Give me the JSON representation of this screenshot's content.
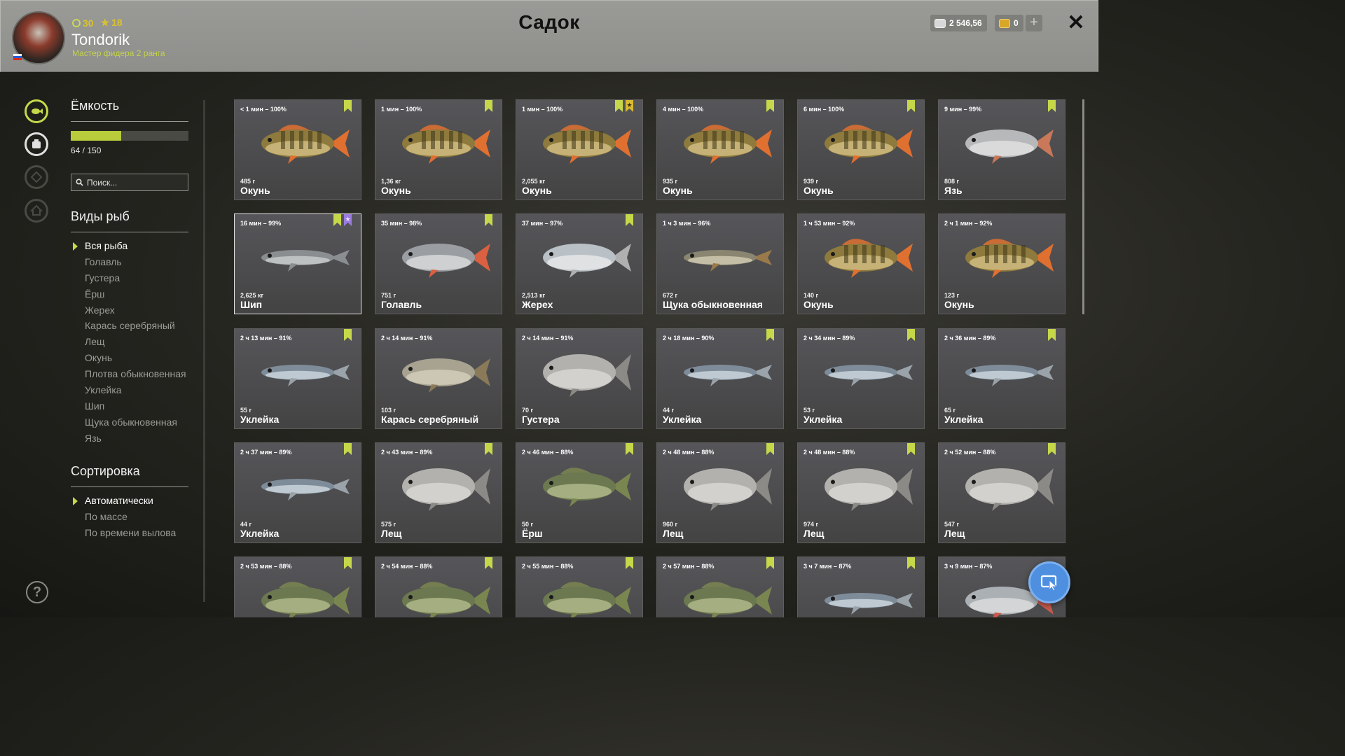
{
  "header": {
    "title": "Садок",
    "username": "Tondorik",
    "rank": "Мастер фидера 2 ранга",
    "level": "30",
    "stars": "18",
    "silver": "2 546,56",
    "gold": "0",
    "close_label": "✕",
    "add_label": "+"
  },
  "sidebar": {
    "capacity_title": "Ёмкость",
    "capacity_text": "64 / 150",
    "capacity_fraction": 0.427,
    "search_placeholder": "Поиск...",
    "species_title": "Виды рыб",
    "species": [
      "Вся рыба",
      "Голавль",
      "Густера",
      "Ёрш",
      "Жерех",
      "Карась серебряный",
      "Лещ",
      "Окунь",
      "Плотва обыкновенная",
      "Уклейка",
      "Шип",
      "Щука обыкновенная",
      "Язь"
    ],
    "species_selected": 0,
    "sort_title": "Сортировка",
    "sort_options": [
      "Автоматически",
      "По массе",
      "По времени вылова"
    ],
    "sort_selected": 0,
    "help_label": "?"
  },
  "colors": {
    "accent": "#c6d84a",
    "bookmark_green": "#c6d84a",
    "bookmark_purple": "#9b7be0",
    "bookmark_gold": "#d9b930",
    "fab": "#4e8fe0"
  },
  "fish": [
    {
      "time": "< 1 мин – 100%",
      "weight": "485 г",
      "name": "Окунь",
      "kind": "perch",
      "marks": [
        "green"
      ]
    },
    {
      "time": "1 мин – 100%",
      "weight": "1,36 кг",
      "name": "Окунь",
      "kind": "perch",
      "marks": [
        "green"
      ]
    },
    {
      "time": "1 мин – 100%",
      "weight": "2,055 кг",
      "name": "Окунь",
      "kind": "perch",
      "marks": [
        "green",
        "gold"
      ]
    },
    {
      "time": "4 мин – 100%",
      "weight": "935 г",
      "name": "Окунь",
      "kind": "perch",
      "marks": [
        "green"
      ]
    },
    {
      "time": "6 мин – 100%",
      "weight": "939 г",
      "name": "Окунь",
      "kind": "perch",
      "marks": [
        "green"
      ]
    },
    {
      "time": "9 мин – 99%",
      "weight": "808 г",
      "name": "Язь",
      "kind": "ide",
      "marks": [
        "green"
      ]
    },
    {
      "time": "16 мин – 99%",
      "weight": "2,625 кг",
      "name": "Шип",
      "kind": "sturgeon",
      "marks": [
        "green",
        "purple"
      ],
      "selected": true
    },
    {
      "time": "35 мин – 98%",
      "weight": "751 г",
      "name": "Голавль",
      "kind": "chub",
      "marks": [
        "green"
      ]
    },
    {
      "time": "37 мин – 97%",
      "weight": "2,513 кг",
      "name": "Жерех",
      "kind": "asp",
      "marks": [
        "green"
      ]
    },
    {
      "time": "1 ч 3 мин – 96%",
      "weight": "672 г",
      "name": "Щука обыкновенная",
      "kind": "pike",
      "marks": []
    },
    {
      "time": "1 ч 53 мин – 92%",
      "weight": "140 г",
      "name": "Окунь",
      "kind": "perch",
      "marks": []
    },
    {
      "time": "2 ч 1 мин – 92%",
      "weight": "123 г",
      "name": "Окунь",
      "kind": "perch",
      "marks": []
    },
    {
      "time": "2 ч 13 мин – 91%",
      "weight": "55 г",
      "name": "Уклейка",
      "kind": "bleak",
      "marks": [
        "green"
      ]
    },
    {
      "time": "2 ч 14 мин – 91%",
      "weight": "103 г",
      "name": "Карась серебряный",
      "kind": "carp",
      "marks": []
    },
    {
      "time": "2 ч 14 мин – 91%",
      "weight": "70 г",
      "name": "Густера",
      "kind": "bream",
      "marks": []
    },
    {
      "time": "2 ч 18 мин – 90%",
      "weight": "44 г",
      "name": "Уклейка",
      "kind": "bleak",
      "marks": [
        "green"
      ]
    },
    {
      "time": "2 ч 34 мин – 89%",
      "weight": "53 г",
      "name": "Уклейка",
      "kind": "bleak",
      "marks": [
        "green"
      ]
    },
    {
      "time": "2 ч 36 мин – 89%",
      "weight": "65 г",
      "name": "Уклейка",
      "kind": "bleak",
      "marks": [
        "green"
      ]
    },
    {
      "time": "2 ч 37 мин – 89%",
      "weight": "44 г",
      "name": "Уклейка",
      "kind": "bleak",
      "marks": [
        "green"
      ]
    },
    {
      "time": "2 ч 43 мин – 89%",
      "weight": "575 г",
      "name": "Лещ",
      "kind": "bream",
      "marks": [
        "green"
      ]
    },
    {
      "time": "2 ч 46 мин – 88%",
      "weight": "50 г",
      "name": "Ёрш",
      "kind": "ruffe",
      "marks": [
        "green"
      ]
    },
    {
      "time": "2 ч 48 мин – 88%",
      "weight": "960 г",
      "name": "Лещ",
      "kind": "bream",
      "marks": [
        "green"
      ]
    },
    {
      "time": "2 ч 48 мин – 88%",
      "weight": "974 г",
      "name": "Лещ",
      "kind": "bream",
      "marks": [
        "green"
      ]
    },
    {
      "time": "2 ч 52 мин – 88%",
      "weight": "547 г",
      "name": "Лещ",
      "kind": "bream",
      "marks": [
        "green"
      ]
    },
    {
      "time": "2 ч 53 мин – 88%",
      "weight": "",
      "name": "",
      "kind": "ruffe",
      "marks": [
        "green"
      ]
    },
    {
      "time": "2 ч 54 мин – 88%",
      "weight": "",
      "name": "",
      "kind": "ruffe",
      "marks": [
        "green"
      ]
    },
    {
      "time": "2 ч 55 мин – 88%",
      "weight": "",
      "name": "",
      "kind": "ruffe",
      "marks": [
        "green"
      ]
    },
    {
      "time": "2 ч 57 мин – 88%",
      "weight": "",
      "name": "",
      "kind": "ruffe",
      "marks": [
        "green"
      ]
    },
    {
      "time": "3 ч 7 мин – 87%",
      "weight": "",
      "name": "",
      "kind": "bleak",
      "marks": [
        "green"
      ]
    },
    {
      "time": "3 ч 9 мин – 87%",
      "weight": "",
      "name": "",
      "kind": "roach",
      "marks": []
    }
  ]
}
